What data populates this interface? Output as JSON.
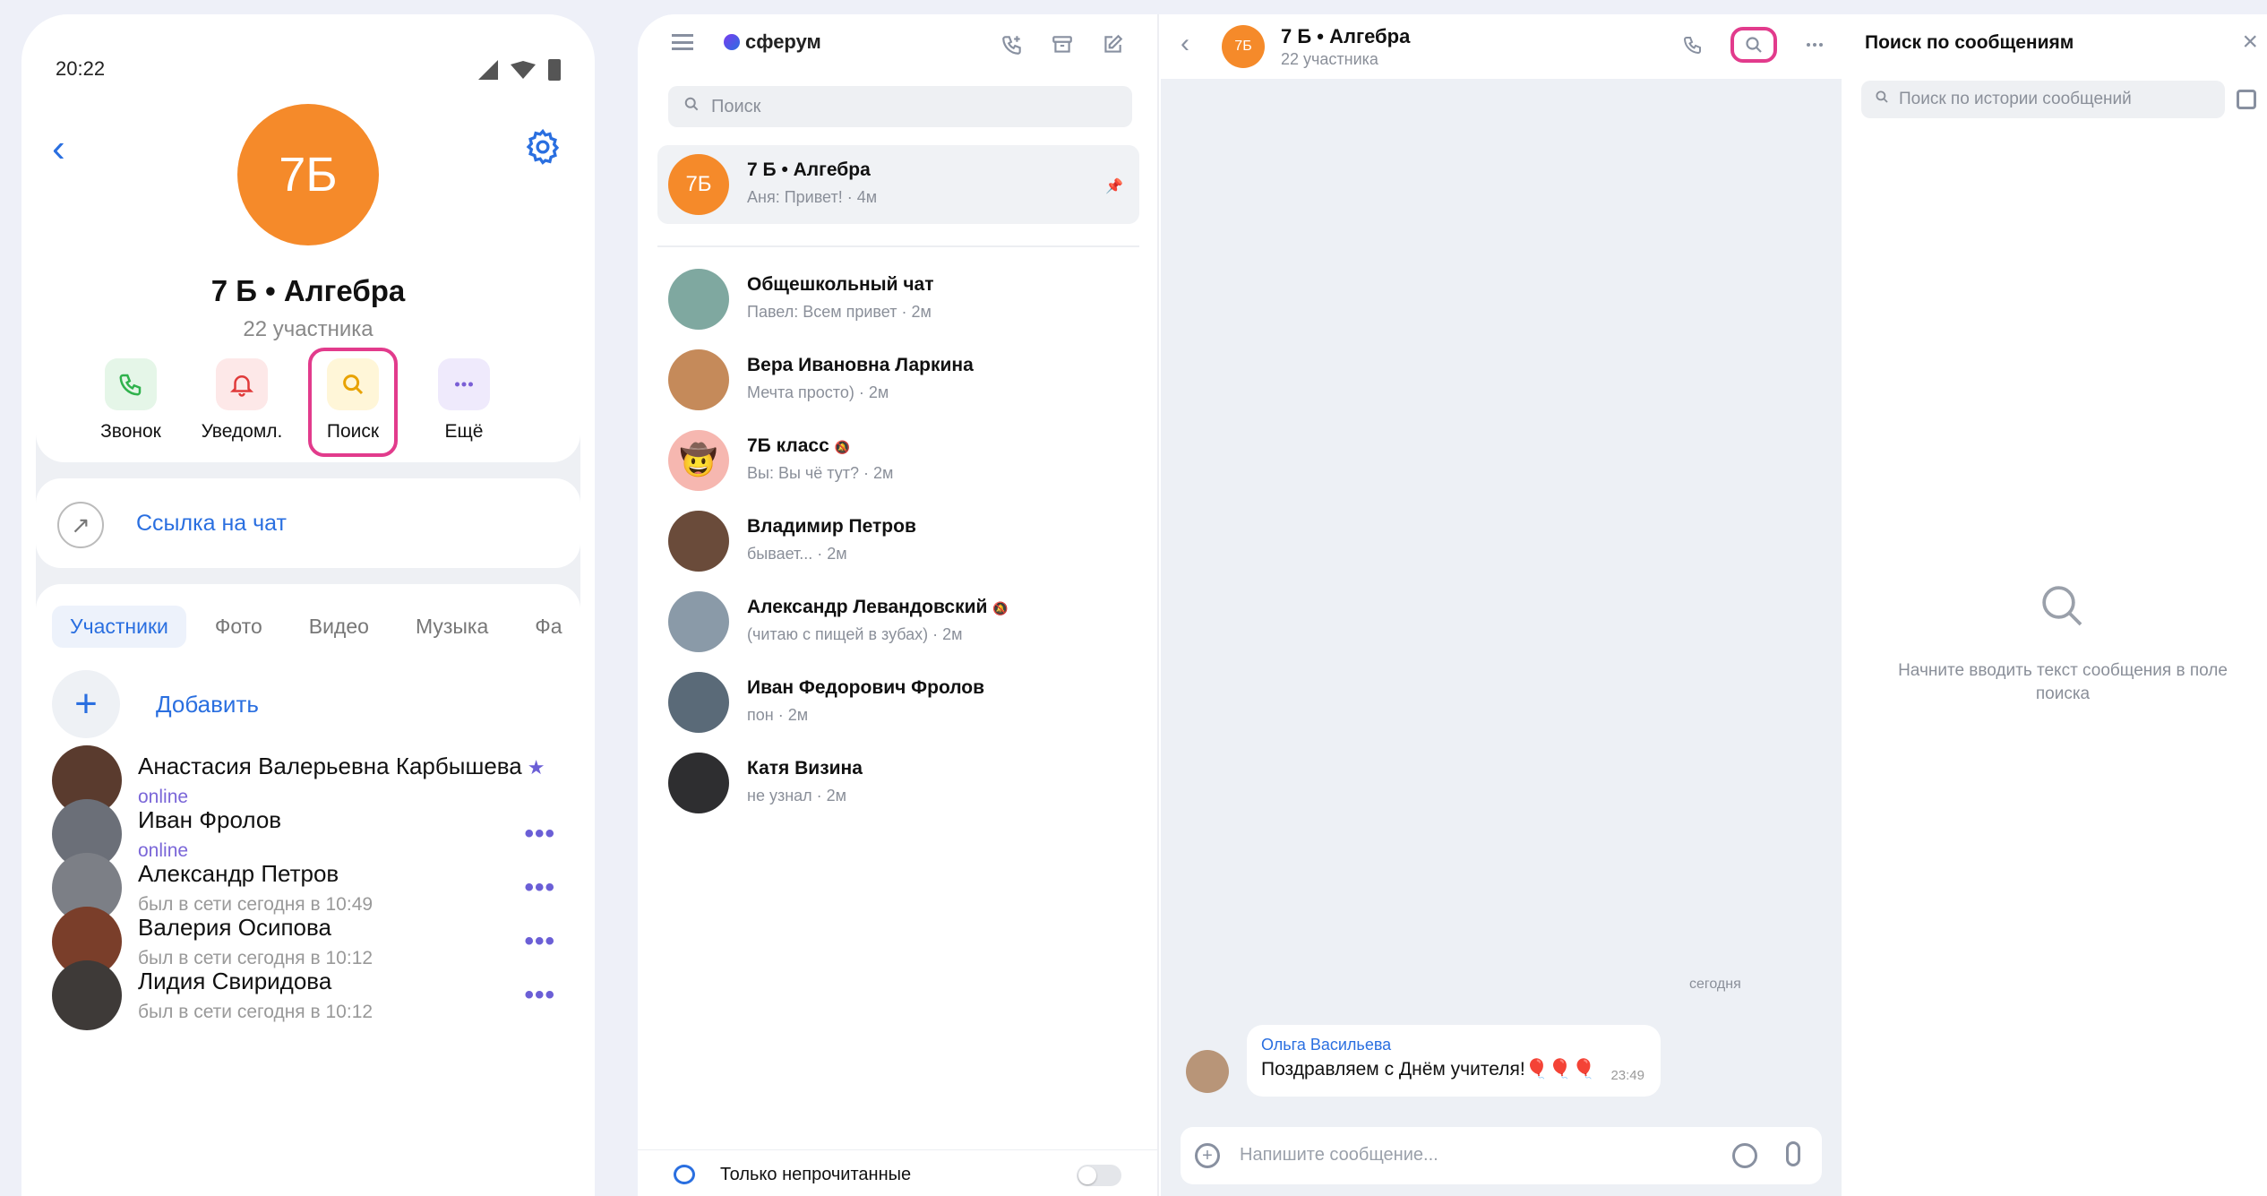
{
  "phone": {
    "time": "20:22",
    "avatar_text": "7Б",
    "title": "7 Б • Алгебра",
    "subtitle": "22 участника",
    "actions": [
      {
        "label": "Звонок",
        "icon": "phone-icon",
        "color": "#2fb24c",
        "bg": "#e5f6e8"
      },
      {
        "label": "Уведомл.",
        "icon": "bell-icon",
        "color": "#e03a3a",
        "bg": "#fde8e8"
      },
      {
        "label": "Поиск",
        "icon": "search-icon",
        "color": "#e8a200",
        "bg": "#fff6d8"
      },
      {
        "label": "Ещё",
        "icon": "more-icon",
        "color": "#7a5fd6",
        "bg": "#efeafc"
      }
    ],
    "link_label": "Ссылка на чат",
    "tabs": [
      "Участники",
      "Фото",
      "Видео",
      "Музыка",
      "Фа"
    ],
    "add_label": "Добавить",
    "members": [
      {
        "name": "Анастасия Валерьевна Карбышева",
        "status": "online",
        "online": true,
        "starred": true,
        "color": "#5a3b2e"
      },
      {
        "name": "Иван Фролов",
        "status": "online",
        "online": true,
        "starred": false,
        "color": "#6b6f78"
      },
      {
        "name": "Александр Петров",
        "status": "был в сети сегодня в 10:49",
        "online": false,
        "starred": false,
        "color": "#7c7f86"
      },
      {
        "name": "Валерия Осипова",
        "status": "был в сети сегодня в 10:12",
        "online": false,
        "starred": false,
        "color": "#7a3e2a"
      },
      {
        "name": "Лидия Свиридова",
        "status": "был в сети сегодня в 10:12",
        "online": false,
        "starred": false,
        "color": "#3e3a38"
      }
    ]
  },
  "sidebar": {
    "logo": "сферум",
    "search_placeholder": "Поиск",
    "pinned_chat": {
      "avatar": "7Б",
      "name": "7 Б • Алгебра",
      "preview": "Аня: Привет! · 4м"
    },
    "chats": [
      {
        "name": "Общешкольный чат",
        "preview": "Павел: Всем привет · 2м",
        "muted": false,
        "color": "#7fa8a0"
      },
      {
        "name": "Вера Ивановна Ларкина",
        "preview": "Мечта просто) · 2м",
        "muted": false,
        "color": "#c58a5a"
      },
      {
        "name": "7Б класс",
        "preview": "Вы: Вы чё тут? · 2м",
        "muted": true,
        "color": "#f6b7b0"
      },
      {
        "name": "Владимир Петров",
        "preview": "бывает... · 2м",
        "muted": false,
        "color": "#6a4b3a"
      },
      {
        "name": "Александр Левандовский",
        "preview": "(читаю с пищей в зубах) · 2м",
        "muted": true,
        "color": "#8a9aa8"
      },
      {
        "name": "Иван Федорович Фролов",
        "preview": "пон · 2м",
        "muted": false,
        "color": "#5a6a78"
      },
      {
        "name": "Катя Визина",
        "preview": "не узнал · 2м",
        "muted": false,
        "color": "#2e2e30"
      }
    ],
    "unread_only_label": "Только непрочитанные"
  },
  "conversation": {
    "avatar": "7Б",
    "title": "7 Б • Алгебра",
    "subtitle": "22 участника",
    "date_separator": "сегодня",
    "message": {
      "author": "Ольга Васильева",
      "text": "Поздравляем с Днём учителя!🎈🎈🎈",
      "time": "23:49"
    },
    "composer_placeholder": "Напишите сообщение..."
  },
  "search_pane": {
    "title": "Поиск по сообщениям",
    "input_placeholder": "Поиск по истории сообщений",
    "empty_text": "Начните вводить текст сообщения в поле поиска"
  },
  "colors": {
    "accent": "#2a6fe0",
    "highlight": "#e23b8c",
    "orange": "#f58a2a"
  }
}
